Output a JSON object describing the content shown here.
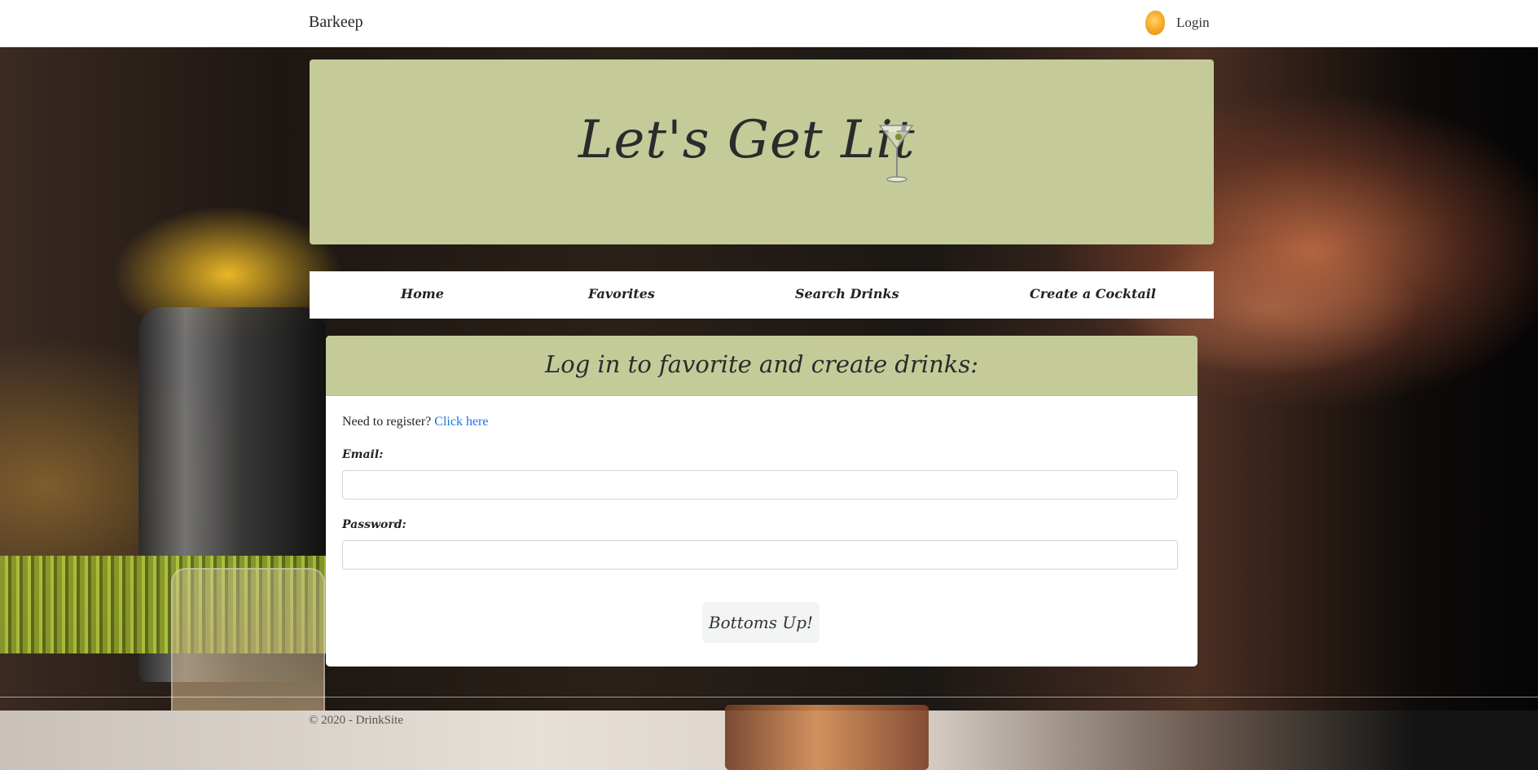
{
  "navbar": {
    "brand": "Barkeep",
    "login_label": "Login",
    "avatar_icon": "avatar-icon"
  },
  "hero": {
    "title": "Let's Get Lit",
    "icon": "martini-icon"
  },
  "nav": {
    "items": [
      {
        "label": "Home"
      },
      {
        "label": "Favorites"
      },
      {
        "label": "Search Drinks"
      },
      {
        "label": "Create a Cocktail"
      }
    ]
  },
  "login_card": {
    "title": "Log in to favorite and create drinks:",
    "register_prompt": "Need to register?",
    "register_link": "Click here",
    "email_label": "Email:",
    "email_value": "",
    "password_label": "Password:",
    "password_value": "",
    "submit_label": "Bottoms Up!"
  },
  "footer": {
    "text": "© 2020 - DrinkSite"
  },
  "colors": {
    "hero_bg": "#c4cb99",
    "link": "#1a73e8"
  }
}
